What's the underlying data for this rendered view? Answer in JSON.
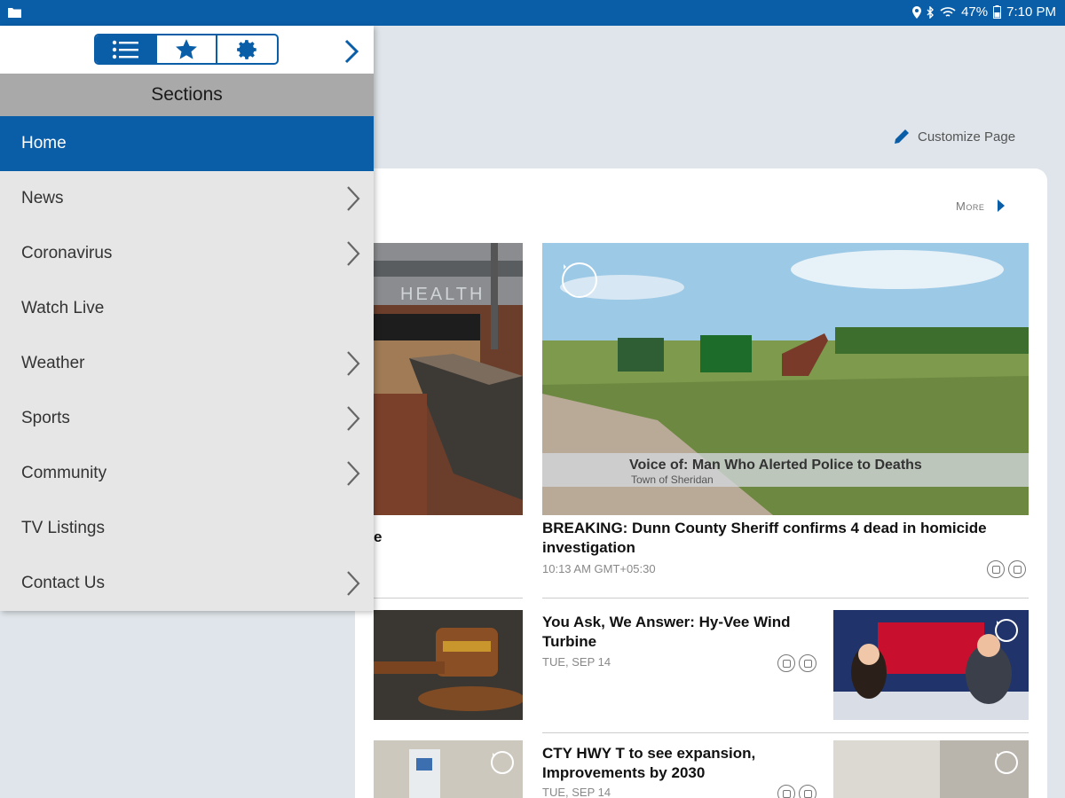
{
  "status_bar": {
    "battery": "47%",
    "time": "7:10 PM"
  },
  "toolbar": {
    "customize_label": "Customize Page",
    "more_label": "More"
  },
  "drawer": {
    "title": "Sections",
    "items": [
      {
        "label": "Home",
        "has_submenu": false,
        "selected": true
      },
      {
        "label": "News",
        "has_submenu": true
      },
      {
        "label": "Coronavirus",
        "has_submenu": true
      },
      {
        "label": "Watch Live",
        "has_submenu": false
      },
      {
        "label": "Weather",
        "has_submenu": true
      },
      {
        "label": "Sports",
        "has_submenu": true
      },
      {
        "label": "Community",
        "has_submenu": true
      },
      {
        "label": "TV Listings",
        "has_submenu": false
      },
      {
        "label": "Contact Us",
        "has_submenu": true
      }
    ]
  },
  "stories": {
    "featured": {
      "headline": "BREAKING: Dunn County Sheriff confirms 4 dead in homicide investigation",
      "timestamp": "10:13 AM GMT+05:30",
      "video_caption": "Voice of: Man Who Alerted Police to Deaths",
      "video_subcaption": "Town of Sheridan"
    },
    "left_partial": {
      "headline_fragment": "e",
      "image_sign": "HEALTH"
    },
    "story2": {
      "headline": "You Ask, We Answer: Hy-Vee Wind Turbine",
      "date": "TUE, SEP 14"
    },
    "story3": {
      "headline": "CTY HWY T to see expansion, Improvements by 2030",
      "date": "TUE, SEP 14"
    }
  },
  "colors": {
    "accent": "#0a5ea8",
    "sections_header": "#a9a9a9",
    "drawer_bg": "#e6e6e6"
  }
}
